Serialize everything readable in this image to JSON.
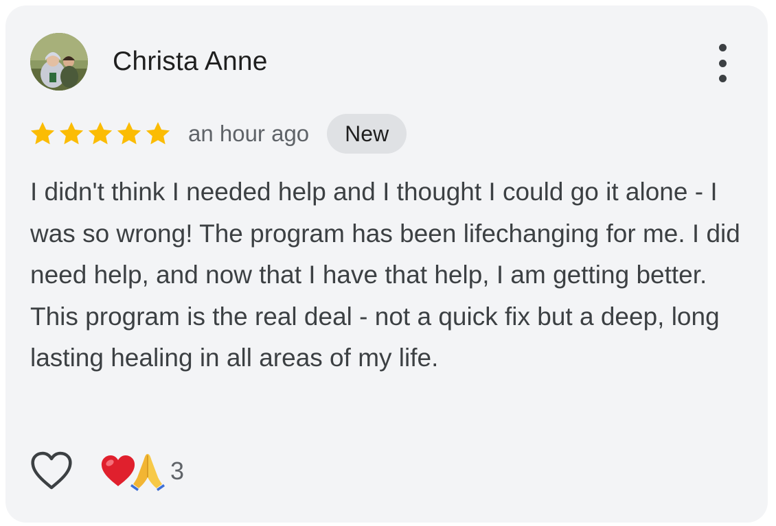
{
  "review": {
    "author": "Christa Anne",
    "rating": 5,
    "rating_max": 5,
    "time": "an hour ago",
    "badge": "New",
    "text": "I didn't think I needed help and I thought I could go it alone - I was so wrong! The program has been lifechanging for me. I did need help, and now that I have that help, I am getting better. This program is the real deal - not a quick fix but a deep, long lasting healing in all areas of my life."
  },
  "actions": {
    "reaction_count": "3",
    "reaction_icons": [
      "red-heart-emoji",
      "folded-hands-emoji"
    ],
    "like_icon": "heart-outline-icon"
  },
  "colors": {
    "card_background": "#f3f4f6",
    "star": "#fbbc04",
    "badge_background": "#dfe1e4",
    "text_primary": "#1f1f1f",
    "text_secondary": "#5f6368"
  }
}
